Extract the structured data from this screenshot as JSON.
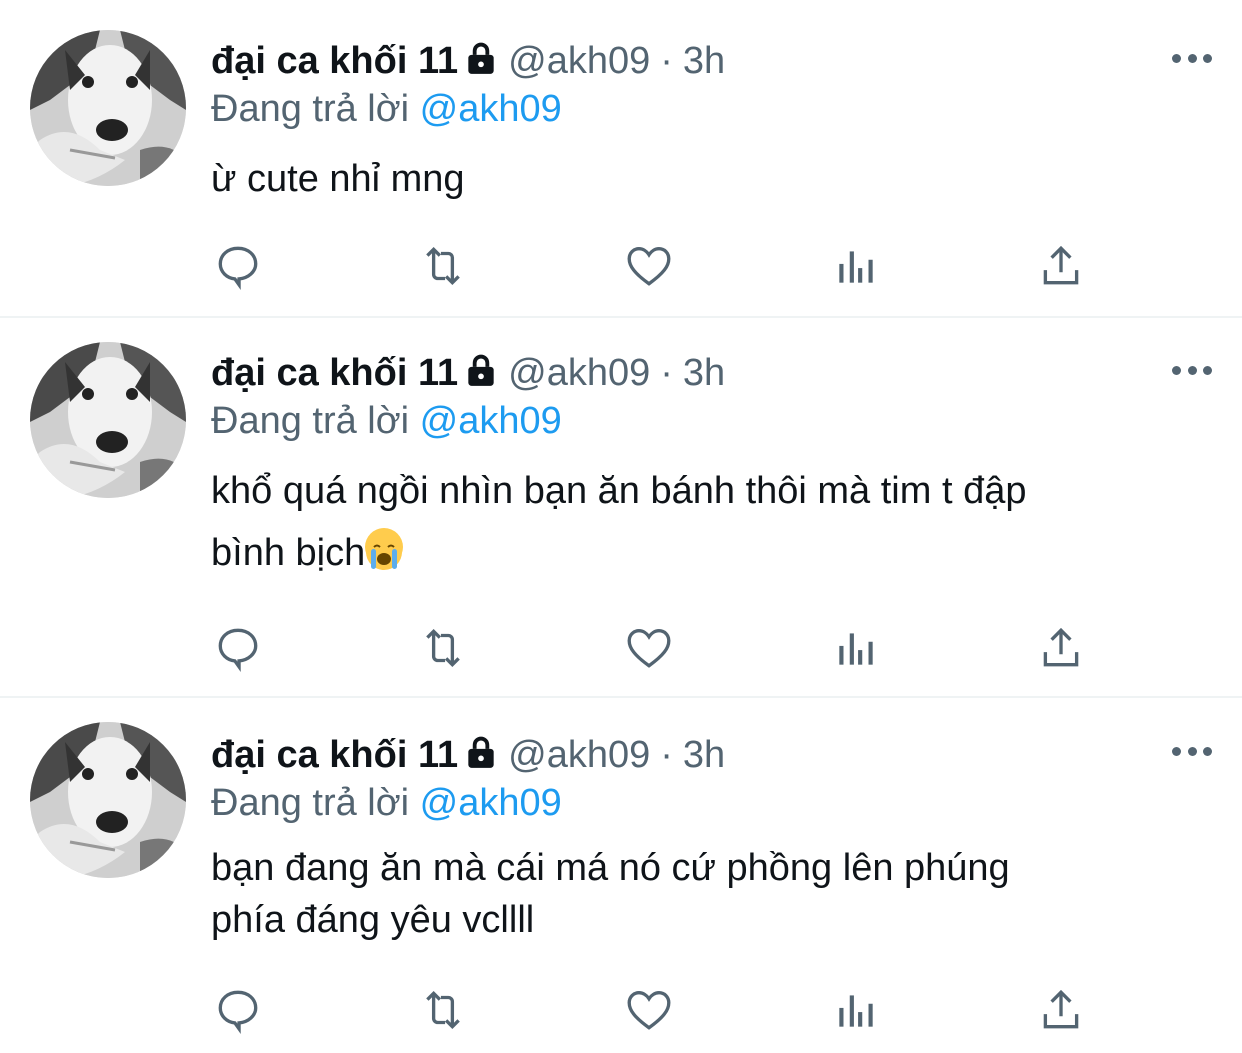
{
  "tweets": [
    {
      "author_name": "đại ca khối 11",
      "handle": "@akh09",
      "separator": "·",
      "time": "3h",
      "replying_prefix": "Đang trả lời",
      "replying_to": "@akh09",
      "text": "ừ cute nhỉ mng",
      "text_line2": ""
    },
    {
      "author_name": "đại ca khối 11",
      "handle": "@akh09",
      "separator": "·",
      "time": "3h",
      "replying_prefix": "Đang trả lời",
      "replying_to": "@akh09",
      "text": "khổ quá ngồi nhìn bạn ăn bánh thôi mà tim t đập",
      "text_line2": "bình bịch"
    },
    {
      "author_name": "đại ca khối 11",
      "handle": "@akh09",
      "separator": "·",
      "time": "3h",
      "replying_prefix": "Đang trả lời",
      "replying_to": "@akh09",
      "text": "bạn đang ăn mà cái má nó cứ phồng lên phúng",
      "text_line2": "phía đáng yêu vcllll"
    }
  ],
  "icons": {
    "reply": "reply-icon",
    "retweet": "retweet-icon",
    "like": "heart-icon",
    "views": "views-icon",
    "share": "share-icon",
    "more": "more-icon",
    "lock": "lock-icon"
  },
  "colors": {
    "text": "#0f1419",
    "secondary": "#536471",
    "accent": "#1d9bf0",
    "divider": "#eff3f4"
  }
}
